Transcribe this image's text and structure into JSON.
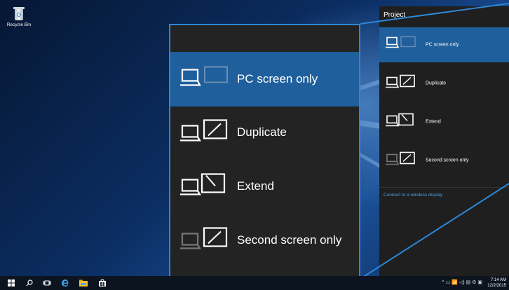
{
  "desktop": {
    "recycle_bin_label": "Recycle Bin"
  },
  "project_panel": {
    "title": "Project",
    "items": [
      {
        "label": "PC screen only",
        "icon": "pc-screen-only-icon",
        "selected": true
      },
      {
        "label": "Duplicate",
        "icon": "duplicate-icon",
        "selected": false
      },
      {
        "label": "Extend",
        "icon": "extend-icon",
        "selected": false
      },
      {
        "label": "Second screen only",
        "icon": "second-screen-only-icon",
        "selected": false
      }
    ],
    "wireless_link": "Connect to a wireless display"
  },
  "zoom_callout": {
    "items": [
      {
        "label": "PC screen only",
        "selected": true
      },
      {
        "label": "Duplicate",
        "selected": false
      },
      {
        "label": "Extend",
        "selected": false
      },
      {
        "label": "Second screen only",
        "selected": false
      }
    ]
  },
  "taskbar": {
    "icons": [
      "start-icon",
      "search-icon",
      "task-view-icon",
      "edge-icon",
      "file-explorer-icon",
      "store-icon"
    ],
    "clock_time": "7:14 AM",
    "clock_date": "12/2/2015"
  },
  "colors": {
    "accent": "#1f5f9c",
    "highlight_border": "#2d86d6",
    "panel_bg": "#1f1f1f",
    "link": "#4aa0e8"
  }
}
